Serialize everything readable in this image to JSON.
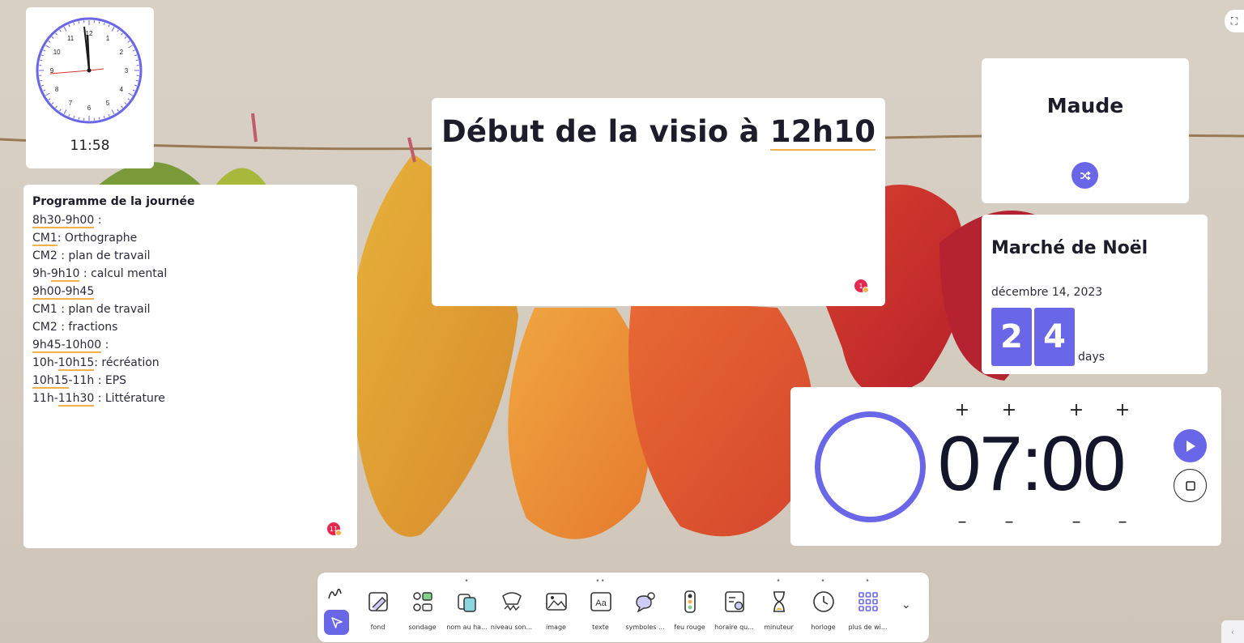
{
  "colors": {
    "accent": "#6a66e8",
    "underline": "#f4b24a",
    "badge": "#e5284f"
  },
  "clock": {
    "digital": "11:58",
    "numbers": [
      "12",
      "1",
      "2",
      "3",
      "4",
      "5",
      "6",
      "7",
      "8",
      "9",
      "10",
      "11"
    ]
  },
  "programme": {
    "title": "Programme de la journée",
    "badge": "11",
    "lines": [
      {
        "text": "8h30-9h00 :",
        "u": "8h30-9h00"
      },
      {
        "text": "CM1: Orthographe",
        "u": "CM1"
      },
      {
        "text": "CM2 : plan de travail"
      },
      {
        "text": "9h-9h10 : calcul mental",
        "u": "9h10"
      },
      {
        "text": "9h00-9h45",
        "u": "9h00-9h45"
      },
      {
        "text": "CM1 : plan de travail"
      },
      {
        "text": "CM2 : fractions"
      },
      {
        "text": "9h45-10h00 :",
        "u": "9h45-10h00"
      },
      {
        "text": "10h-10h15: récréation",
        "u": "10h15"
      },
      {
        "text": "10h15-11h : EPS",
        "u": "10h15"
      },
      {
        "text": "11h-11h30 : Littérature",
        "u": "11h30"
      }
    ]
  },
  "visio": {
    "text_before": "Début de la visio à ",
    "text_underlined": "12h10",
    "badge": "1"
  },
  "name_picker": {
    "name": "Maude",
    "shuffle_icon": "shuffle-icon"
  },
  "countdown": {
    "title": "Marché de Noël",
    "date": "décembre 14, 2023",
    "digits": [
      "2",
      "4"
    ],
    "unit": "days"
  },
  "timer": {
    "time": "07:00",
    "plus": "+",
    "minus": "–"
  },
  "toolbar": {
    "tools": [
      {
        "label": "fond",
        "icon": "background-icon",
        "dots": ""
      },
      {
        "label": "sondage",
        "icon": "poll-icon",
        "dots": ""
      },
      {
        "label": "nom au ha...",
        "icon": "random-name-icon",
        "dots": "•"
      },
      {
        "label": "niveau son...",
        "icon": "sound-level-icon",
        "dots": ""
      },
      {
        "label": "image",
        "icon": "image-icon",
        "dots": ""
      },
      {
        "label": "texte",
        "icon": "text-icon",
        "dots": "••"
      },
      {
        "label": "symboles ...",
        "icon": "symbols-icon",
        "dots": ""
      },
      {
        "label": "feu rouge",
        "icon": "traffic-light-icon",
        "dots": ""
      },
      {
        "label": "horaire qu...",
        "icon": "schedule-icon",
        "dots": ""
      },
      {
        "label": "minuteur",
        "icon": "hourglass-icon",
        "dots": "•"
      },
      {
        "label": "horloge",
        "icon": "clock-icon",
        "dots": "•"
      },
      {
        "label": "plus de wi...",
        "icon": "grid-icon",
        "dots": "•"
      }
    ]
  }
}
